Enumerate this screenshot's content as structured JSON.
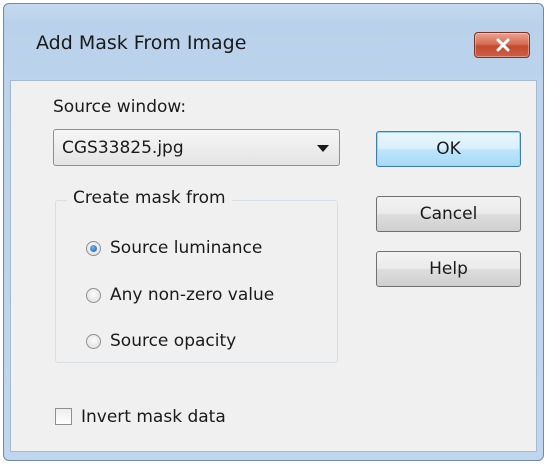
{
  "window": {
    "title": "Add Mask From Image"
  },
  "source": {
    "label": "Source window:",
    "selected": "CGS33825.jpg"
  },
  "create_mask": {
    "legend": "Create mask from",
    "options": [
      {
        "label": "Source luminance",
        "checked": true
      },
      {
        "label": "Any non-zero value",
        "checked": false
      },
      {
        "label": "Source opacity",
        "checked": false
      }
    ]
  },
  "invert": {
    "label": "Invert mask data",
    "checked": false
  },
  "buttons": {
    "ok": "OK",
    "cancel": "Cancel",
    "help": "Help"
  },
  "icons": {
    "close": "close-icon",
    "dropdown": "chevron-down-icon"
  },
  "colors": {
    "title_bar": "#bcd3ec",
    "close_button": "#c24a31",
    "default_button_border": "#3c7fb1",
    "radio_selected": "#1a5c9c"
  }
}
